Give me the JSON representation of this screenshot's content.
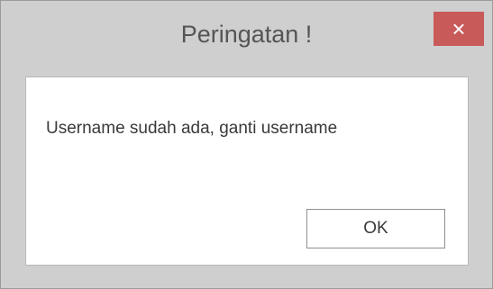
{
  "dialog": {
    "title": "Peringatan !",
    "close_icon": "close-icon",
    "close_glyph": "×",
    "message": "Username sudah ada, ganti username",
    "ok_label": "OK"
  },
  "colors": {
    "title_bar": "#cfcfcf",
    "close_button": "#c85a5a",
    "content_bg": "#ffffff",
    "text": "#3a3a3a"
  }
}
